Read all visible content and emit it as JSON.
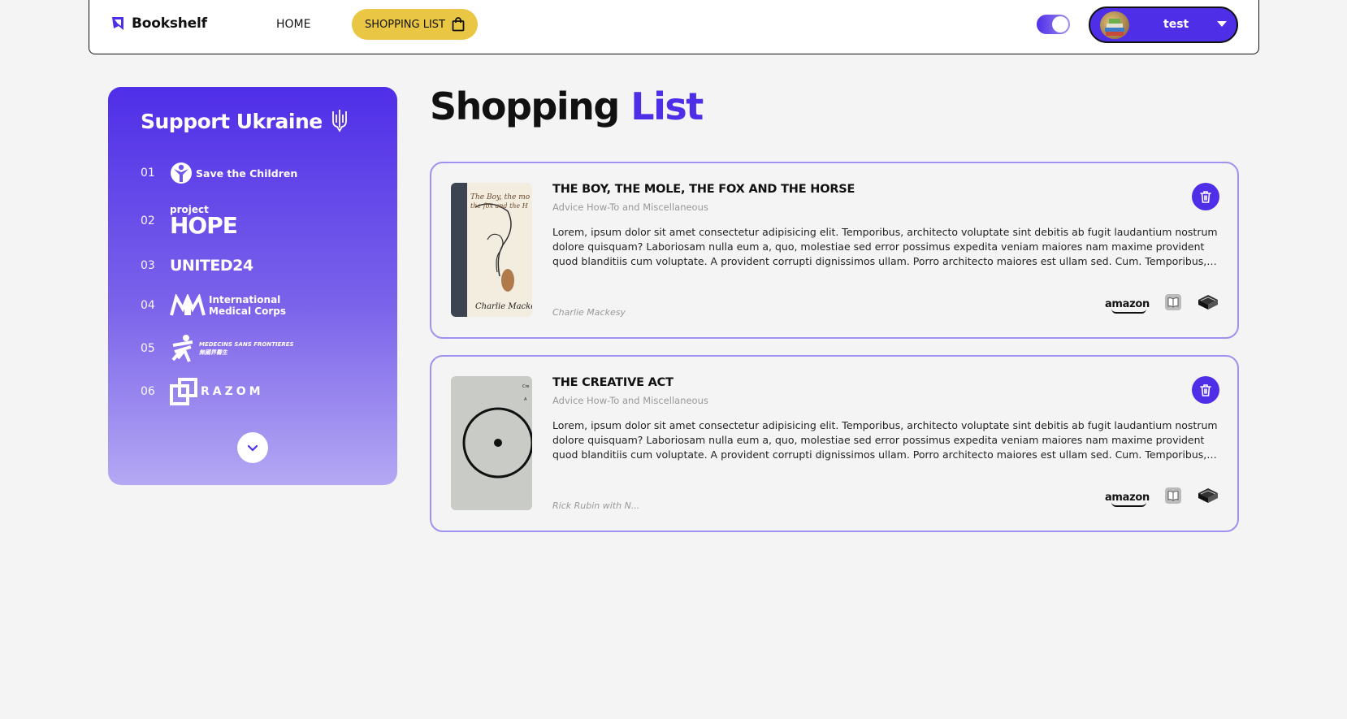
{
  "header": {
    "logo_text": "Bookshelf",
    "nav": {
      "home": "HOME",
      "shopping_list": "SHOPPING LIST"
    },
    "theme_toggle": {
      "on": true
    },
    "user": {
      "name": "test"
    }
  },
  "support": {
    "title": "Support Ukraine",
    "funds": [
      {
        "num": "01",
        "name": "Save the Children"
      },
      {
        "num": "02",
        "name_small": "project",
        "name": "HOPE"
      },
      {
        "num": "03",
        "name": "UNITED24"
      },
      {
        "num": "04",
        "name_line1": "International",
        "name_line2": "Medical Corps"
      },
      {
        "num": "05",
        "name_line1": "MEDECINS SANS FRONTIERES",
        "name_line2": "無國界醫生"
      },
      {
        "num": "06",
        "name": "RAZOM"
      }
    ]
  },
  "page": {
    "title_main": "Shopping",
    "title_accent": "List"
  },
  "books": [
    {
      "title": "THE BOY, THE MOLE, THE FOX AND THE HORSE",
      "category": "Advice How-To and Miscellaneous",
      "description": "Lorem, ipsum dolor sit amet consectetur adipisicing elit. Temporibus, architecto voluptate sint debitis ab fugit laudantium nostrum dolore quisquam? Laboriosam nulla eum a, quo, molestiae sed error possimus expedita veniam maiores nam maxime provident quod blanditiis cum voluptate. A provident corrupti dignissimos ullam. Porro architecto maiores est ullam sed. Cum. Temporibus, architecto voluptate sint debitis ab fugit laudantium.",
      "author": "Charlie Mackesy",
      "shops": [
        "amazon",
        "apple-books-icon",
        "bookshop-icon"
      ]
    },
    {
      "title": "THE CREATIVE ACT",
      "category": "Advice How-To and Miscellaneous",
      "description": "Lorem, ipsum dolor sit amet consectetur adipisicing elit. Temporibus, architecto voluptate sint debitis ab fugit laudantium nostrum dolore quisquam? Laboriosam nulla eum a, quo, molestiae sed error possimus expedita veniam maiores nam maxime provident quod blanditiis cum voluptate. A provident corrupti dignissimos ullam. Porro architecto maiores est ullam sed. Cum. Temporibus, architecto voluptate sint debitis ab fugit laudantium.",
      "author": "Rick Rubin with N...",
      "shops": [
        "amazon",
        "apple-books-icon",
        "bookshop-icon"
      ]
    }
  ],
  "colors": {
    "accent": "#4f2ee8",
    "button_yellow": "#eac645",
    "card_border": "#9e92f0",
    "background": "#f4f4f4"
  }
}
